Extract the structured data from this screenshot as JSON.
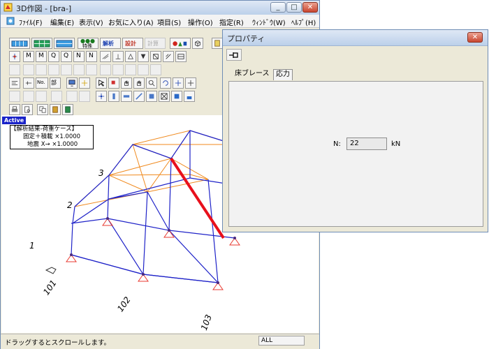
{
  "main_window": {
    "title": "3D作図 - [bra-]",
    "controls": {
      "minimize": "_",
      "maximize": "□",
      "close": "✕"
    },
    "menu": [
      "ﾌｧｲﾙ(F)",
      "編集(E)",
      "表示(V)",
      "お気に入り(A)",
      "項目(S)",
      "操作(O)",
      "指定(R)",
      "ｳｨﾝﾄﾞｳ(W)",
      "ﾍﾙﾌﾟ(H)"
    ],
    "toolbar": {
      "analysis_label": "解析",
      "design_label": "設計",
      "calc_label": "計算",
      "dots_label": "●●●",
      "special_label": "特殊"
    },
    "statusbar": {
      "message": "ドラッグするとスクロールします。",
      "mode": "ALL"
    }
  },
  "viewport": {
    "active_badge": "Active",
    "load_case": {
      "title": "【解析結果-荷重ケース】",
      "line1": "固定＋積載 ×1.0000",
      "line2": "地震 X→ ×1.0000"
    },
    "grid_labels": {
      "y1": "1",
      "y2": "2",
      "y3": "3",
      "x101": "101",
      "x102": "102",
      "x103": "103"
    },
    "colors": {
      "frame": "#1e22c8",
      "brace": "#f08a1e",
      "selected_member": "#e8101c",
      "support": "#e83a30"
    }
  },
  "property_window": {
    "title": "プロパティ",
    "pin_icon": "pin-icon",
    "tabs": [
      "床ブレース",
      "応力"
    ],
    "active_tab": "応力",
    "field_label": "N:",
    "field_value": "22",
    "field_unit": "kN",
    "controls": {
      "close": "✕"
    }
  }
}
